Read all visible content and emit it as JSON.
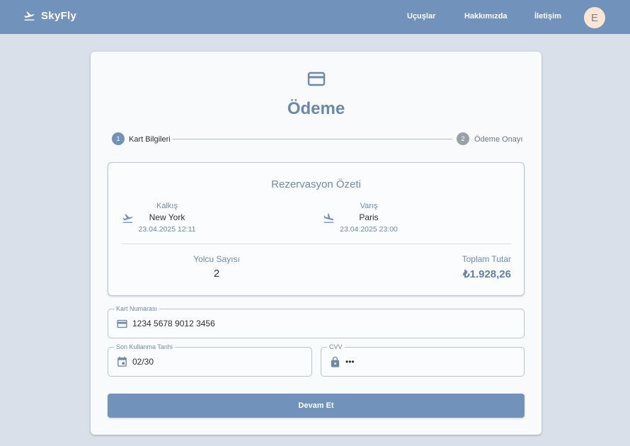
{
  "header": {
    "brand": "SkyFly",
    "nav": [
      "Uçuşlar",
      "Hakkımızda",
      "İletişim"
    ],
    "avatar_initial": "E"
  },
  "page": {
    "title": "Ödeme",
    "icon": "credit-card-icon"
  },
  "stepper": {
    "steps": [
      {
        "number": "1",
        "label": "Kart Bilgileri",
        "state": "active"
      },
      {
        "number": "2",
        "label": "Ödeme Onayı",
        "state": "inactive"
      }
    ]
  },
  "summary": {
    "title": "Rezervasyon Özeti",
    "departure": {
      "label": "Kalkış",
      "city": "New York",
      "time": "23.04.2025 12:11",
      "icon": "flight-takeoff-icon"
    },
    "arrival": {
      "label": "Varış",
      "city": "Paris",
      "time": "23.04.2025 23:00",
      "icon": "flight-land-icon"
    },
    "passengers": {
      "label": "Yolcu Sayısı",
      "value": "2"
    },
    "total": {
      "label": "Toplam Tutar",
      "value": "₺1.928,26"
    }
  },
  "form": {
    "card_number": {
      "label": "Kart Numarası",
      "value": "1234 5678 9012 3456",
      "icon": "credit-card-icon"
    },
    "expiry": {
      "label": "Son Kullanma Tarihi",
      "value": "02/30",
      "icon": "calendar-icon"
    },
    "cvv": {
      "label": "CVV",
      "value": "•••",
      "icon": "lock-icon"
    },
    "submit_label": "Devam Et"
  },
  "colors": {
    "primary": "#7193bb",
    "background": "#d9e0e9",
    "card": "#f8fafc",
    "avatar": "#fbe6d4",
    "step_active": "#7193bb",
    "step_inactive": "#9aa0a8"
  }
}
